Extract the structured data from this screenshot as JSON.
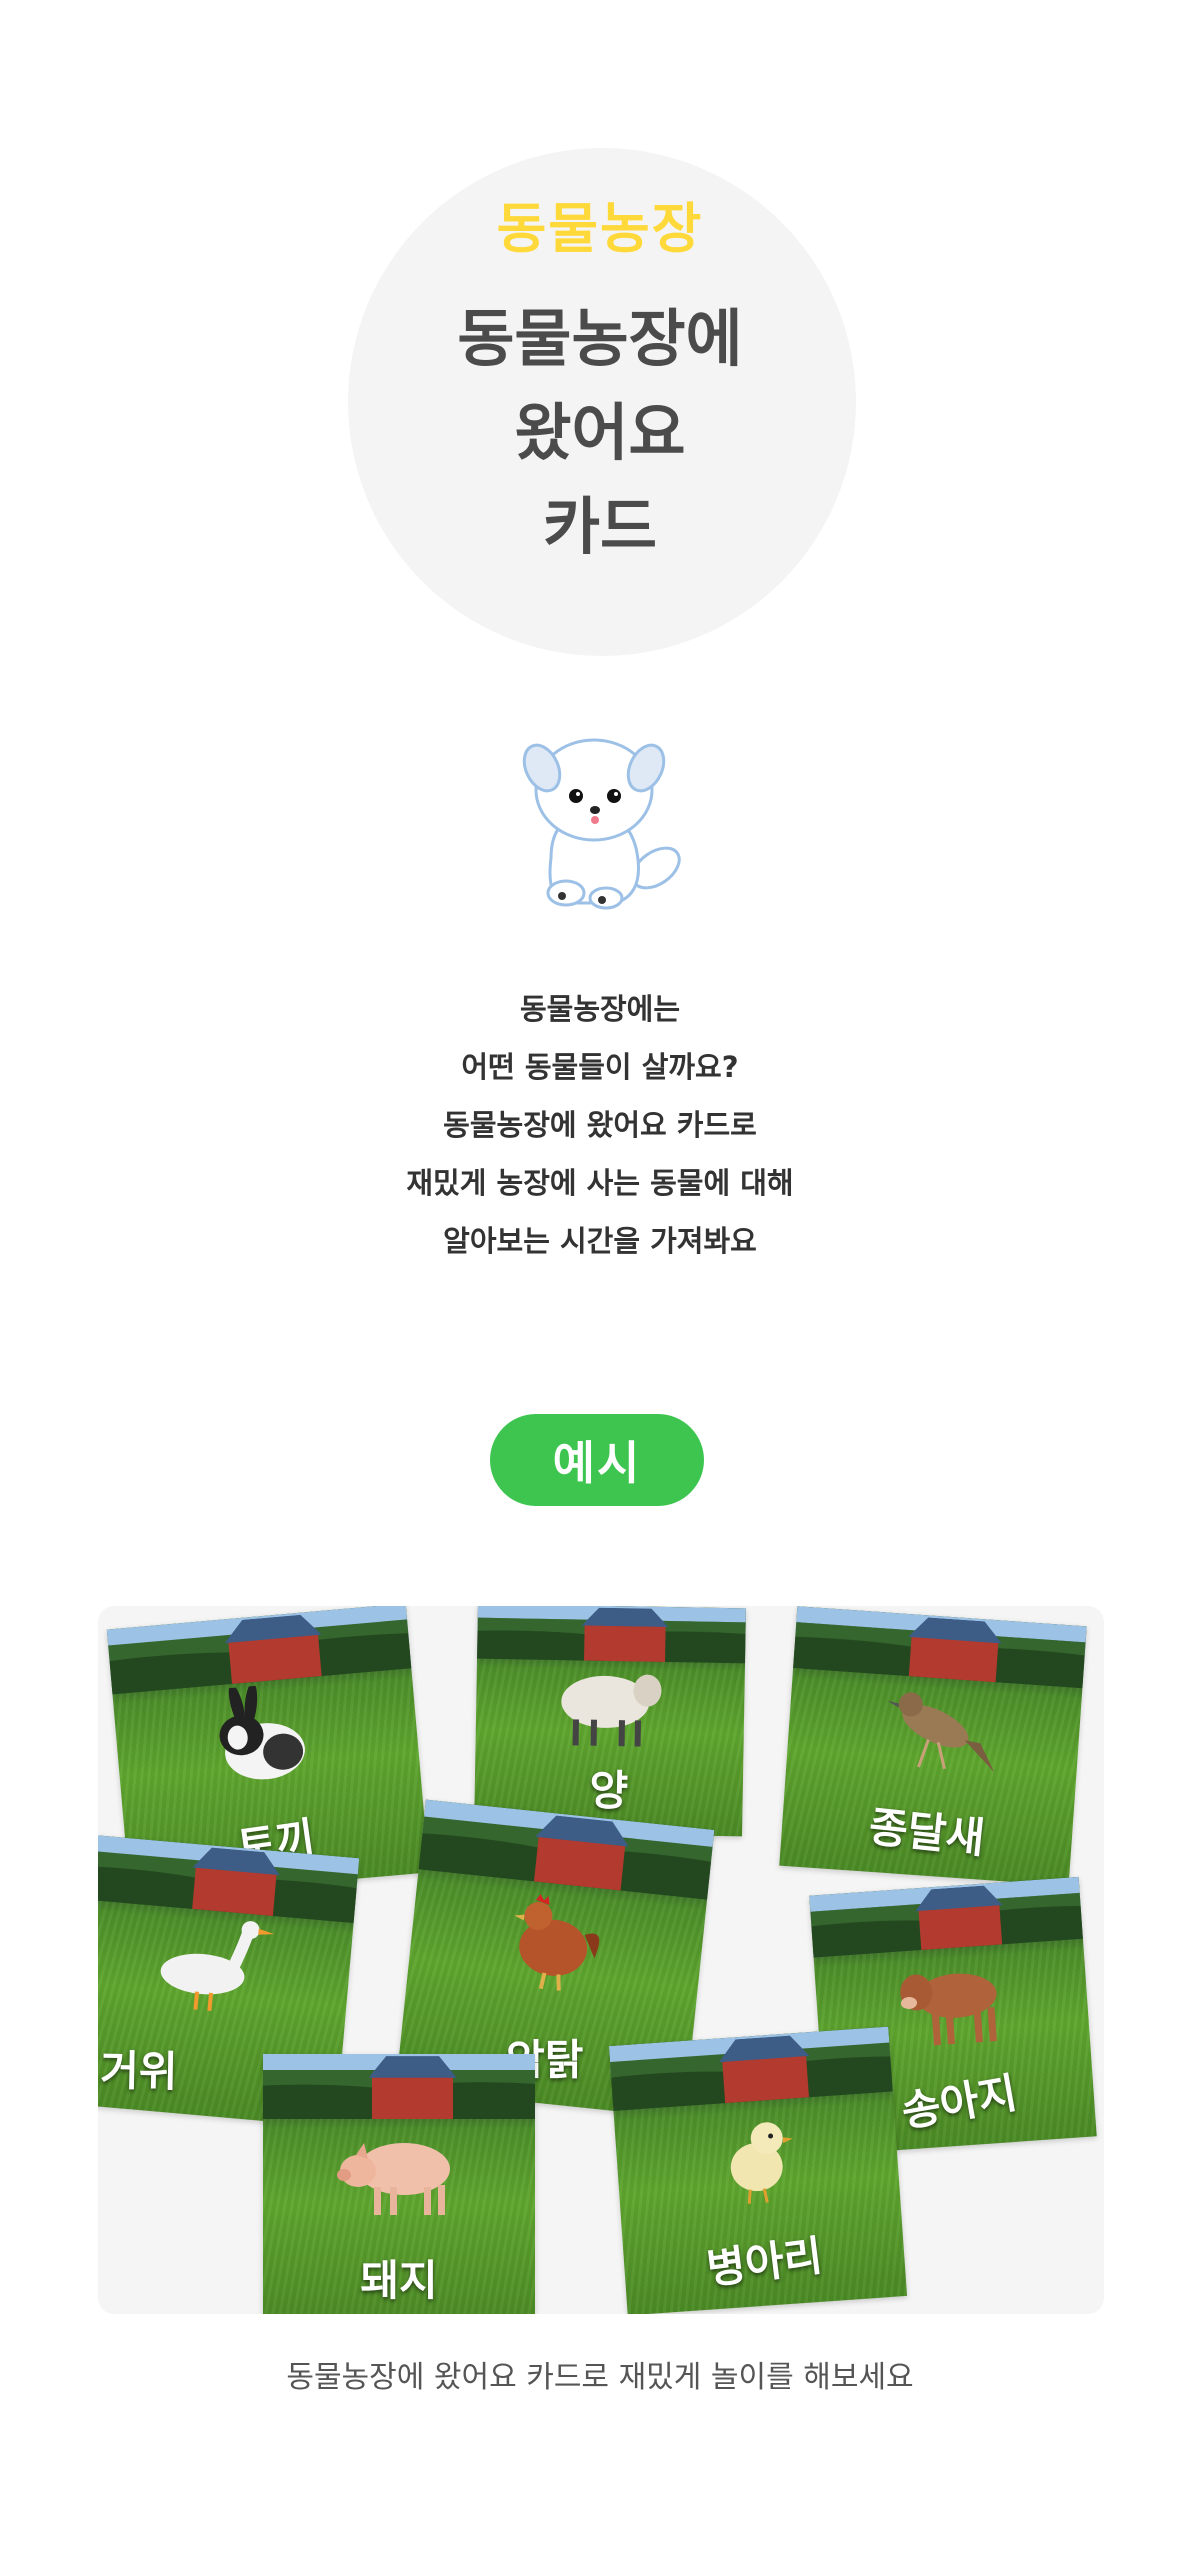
{
  "hero": {
    "subtitle": "동물농장",
    "title_lines": [
      "동물농장에",
      "왔어요",
      "카드"
    ]
  },
  "mascot": {
    "icon": "puppy-icon"
  },
  "intro": {
    "lines": [
      "동물농장에는",
      "어떤 동물들이 살까요?",
      "동물농장에 왔어요 카드로",
      "재밌게 농장에 사는 동물에 대해",
      "알아보는 시간을 가져봐요"
    ]
  },
  "example": {
    "label": "예시"
  },
  "cards": [
    {
      "label": "토끼",
      "animal": "rabbit-icon"
    },
    {
      "label": "양",
      "animal": "sheep-icon"
    },
    {
      "label": "종달새",
      "animal": "lark-icon"
    },
    {
      "label": "거위",
      "animal": "goose-icon"
    },
    {
      "label": "암탉",
      "animal": "hen-icon"
    },
    {
      "label": "송아지",
      "animal": "calf-icon"
    },
    {
      "label": "돼지",
      "animal": "pig-icon"
    },
    {
      "label": "병아리",
      "animal": "chick-icon"
    }
  ],
  "caption": "동물농장에 왔어요 카드로 재밌게 놀이를 해보세요",
  "colors": {
    "accent_yellow": "#ffd83a",
    "accent_green": "#3dc54f",
    "title_gray": "#4b4b4b"
  }
}
